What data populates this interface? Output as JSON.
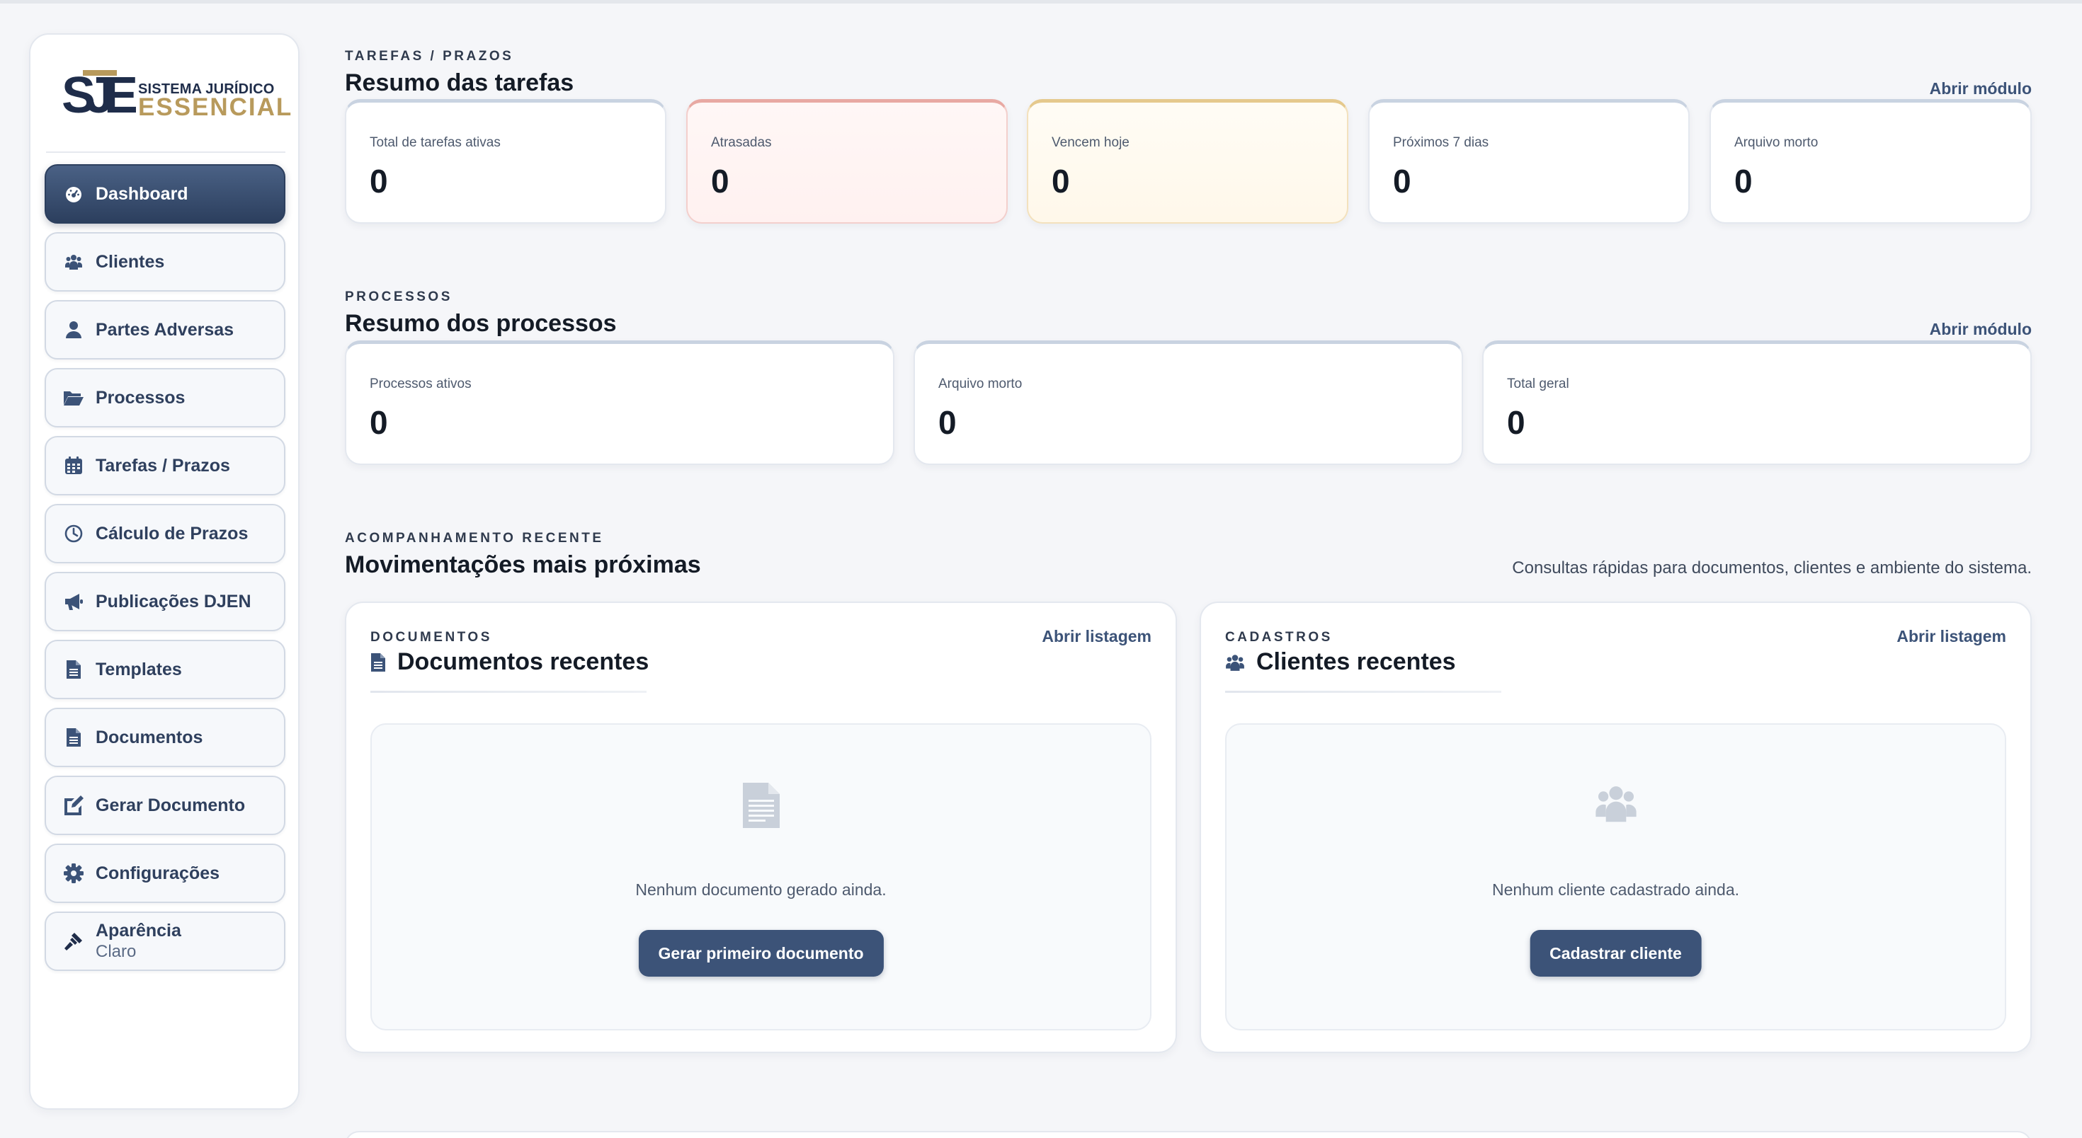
{
  "brand": {
    "line1": "SISTEMA JURÍDICO",
    "line2": "ESSENCIAL"
  },
  "sidebar": {
    "items": [
      {
        "label": "Dashboard",
        "icon": "dashboard-icon",
        "active": true
      },
      {
        "label": "Clientes",
        "icon": "users-icon"
      },
      {
        "label": "Partes Adversas",
        "icon": "user-icon"
      },
      {
        "label": "Processos",
        "icon": "folder-open-icon"
      },
      {
        "label": "Tarefas / Prazos",
        "icon": "calendar-icon"
      },
      {
        "label": "Cálculo de Prazos",
        "icon": "clock-icon"
      },
      {
        "label": "Publicações DJEN",
        "icon": "megaphone-icon"
      },
      {
        "label": "Templates",
        "icon": "file-icon"
      },
      {
        "label": "Documentos",
        "icon": "file-icon"
      },
      {
        "label": "Gerar Documento",
        "icon": "edit-file-icon"
      },
      {
        "label": "Configurações",
        "icon": "gear-icon"
      },
      {
        "label": "Aparência",
        "sublabel": "Claro",
        "icon": "brush-icon"
      }
    ]
  },
  "tasks": {
    "eyebrow": "TAREFAS / PRAZOS",
    "title": "Resumo das tarefas",
    "link": "Abrir módulo",
    "cards": [
      {
        "label": "Total de tarefas ativas",
        "value": "0"
      },
      {
        "label": "Atrasadas",
        "value": "0"
      },
      {
        "label": "Vencem hoje",
        "value": "0"
      },
      {
        "label": "Próximos 7 dias",
        "value": "0"
      },
      {
        "label": "Arquivo morto",
        "value": "0"
      }
    ]
  },
  "processes": {
    "eyebrow": "PROCESSOS",
    "title": "Resumo dos processos",
    "link": "Abrir módulo",
    "cards": [
      {
        "label": "Processos ativos",
        "value": "0"
      },
      {
        "label": "Arquivo morto",
        "value": "0"
      },
      {
        "label": "Total geral",
        "value": "0"
      }
    ]
  },
  "recent": {
    "eyebrow": "ACOMPANHAMENTO RECENTE",
    "title": "Movimentações mais próximas",
    "subtitle": "Consultas rápidas para documentos, clientes e ambiente do sistema.",
    "documents": {
      "eyebrow": "DOCUMENTOS",
      "title": "Documentos recentes",
      "link": "Abrir listagem",
      "empty_text": "Nenhum documento gerado ainda.",
      "button": "Gerar primeiro documento"
    },
    "clients": {
      "eyebrow": "CADASTROS",
      "title": "Clientes recentes",
      "link": "Abrir listagem",
      "empty_text": "Nenhum cliente cadastrado ainda.",
      "button": "Cadastrar cliente"
    }
  },
  "colors": {
    "accent": "#3c5378",
    "sidebar_active": "#2c3f5e",
    "brand_gold": "#b89a5c",
    "brand_navy": "#1f2d4a"
  }
}
